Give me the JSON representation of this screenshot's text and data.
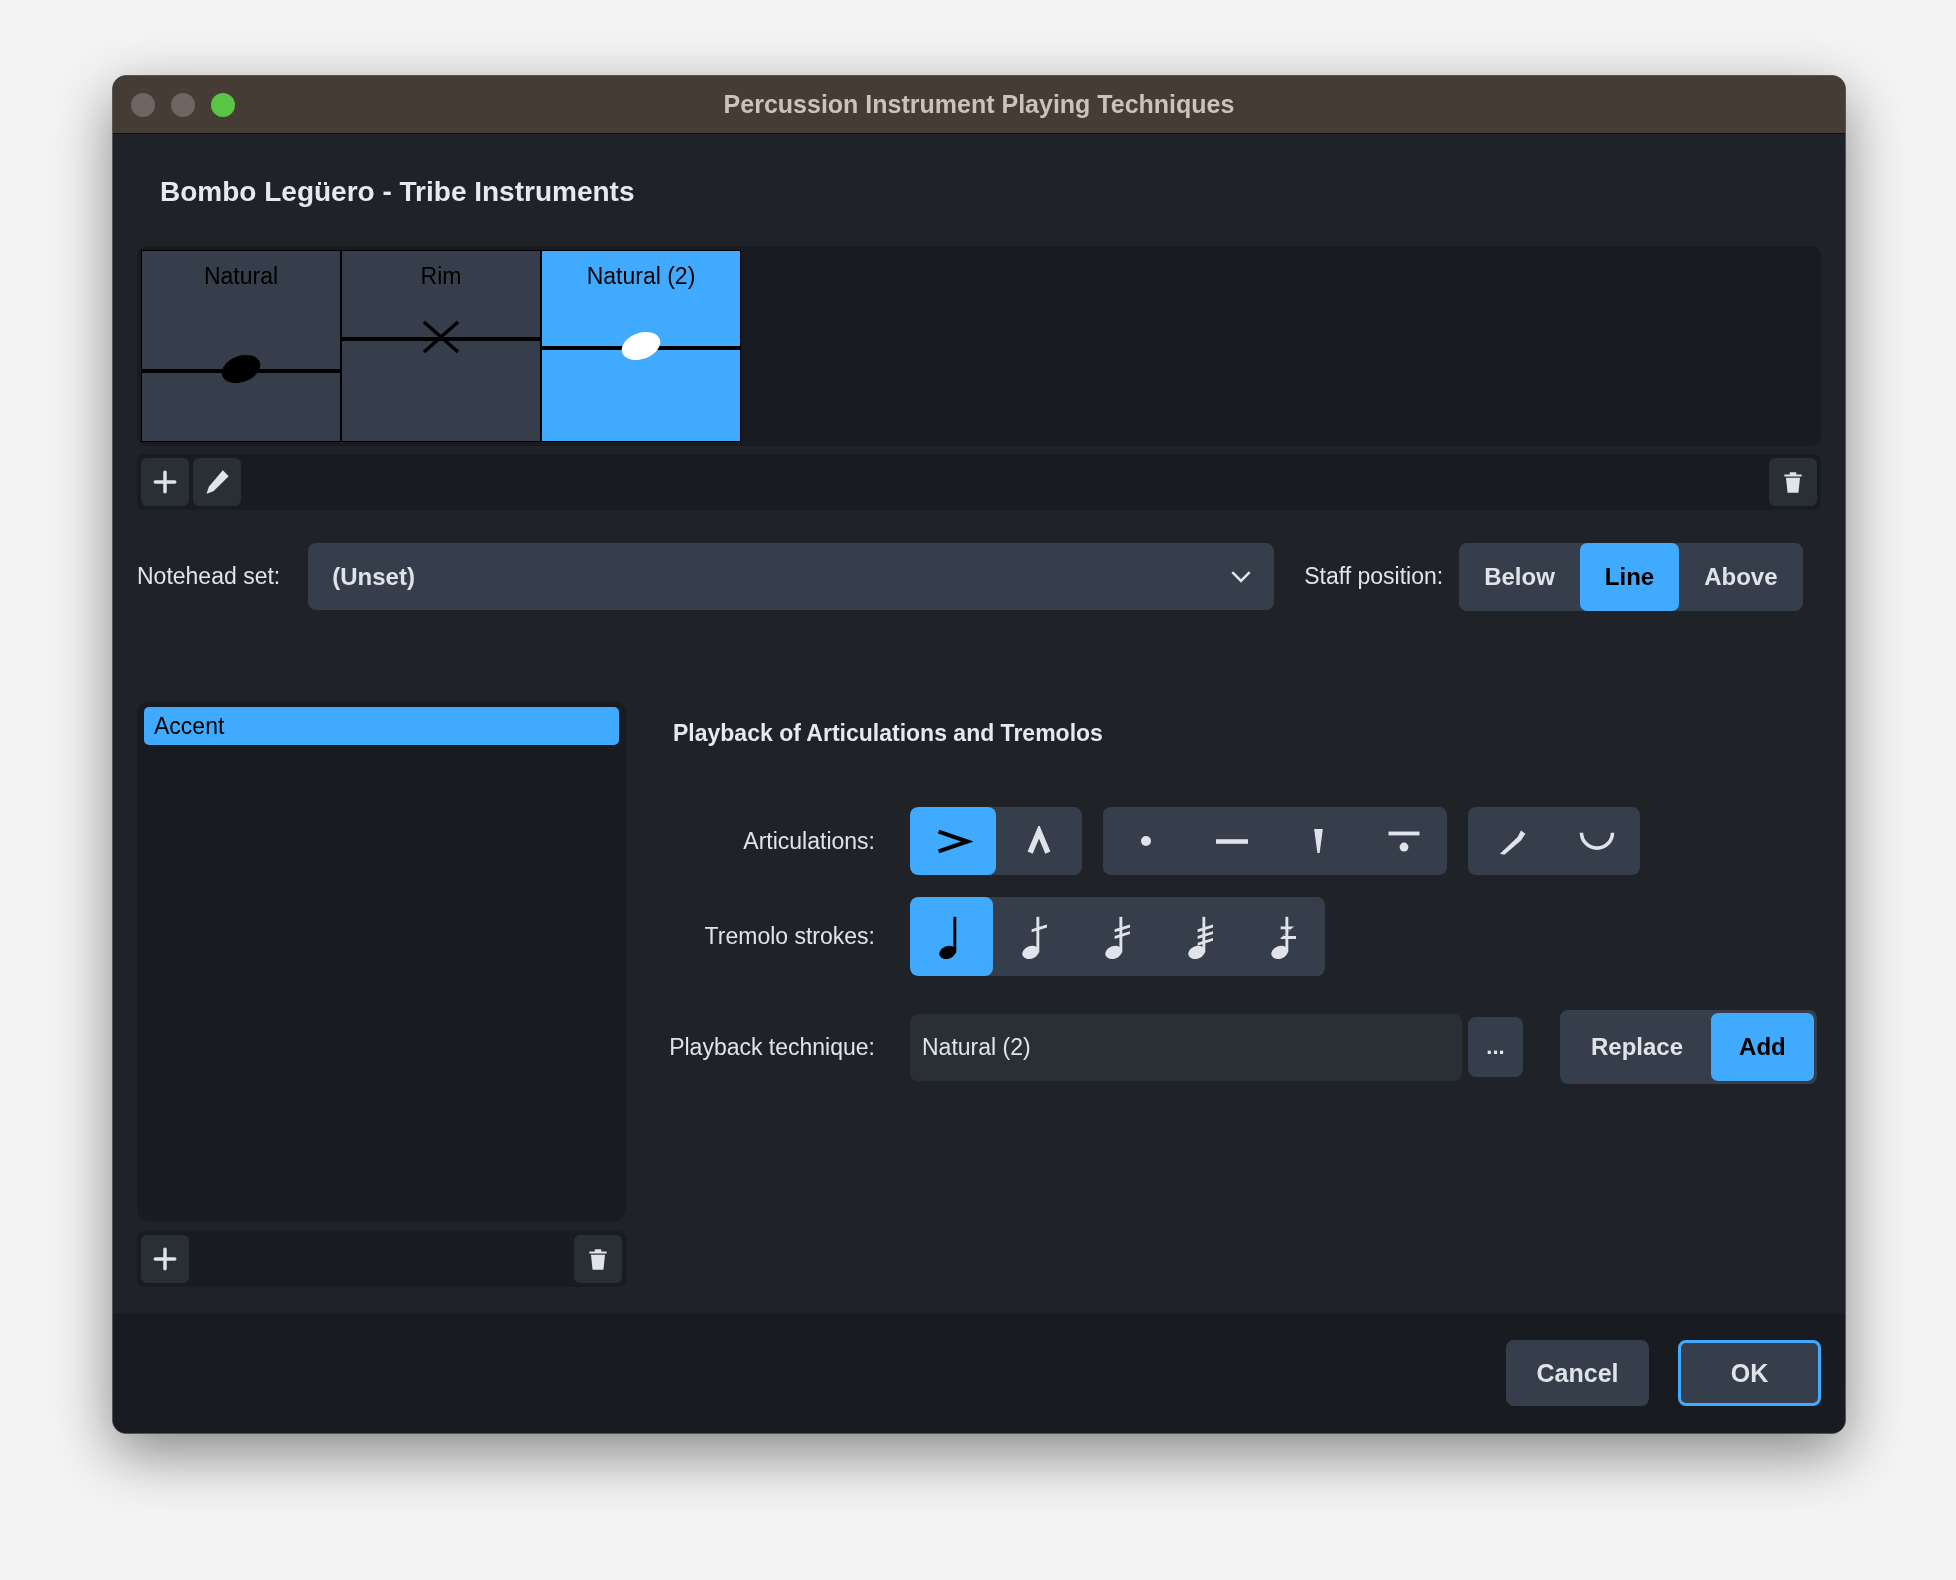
{
  "window": {
    "title": "Percussion Instrument Playing Techniques"
  },
  "heading": "Bombo Legüero - Tribe Instruments",
  "techniques": [
    {
      "label": "Natural",
      "kind": "filled",
      "selected": false
    },
    {
      "label": "Rim",
      "kind": "cross",
      "selected": false
    },
    {
      "label": "Natural (2)",
      "kind": "open",
      "selected": true
    }
  ],
  "notehead_set": {
    "label": "Notehead set:",
    "value": "(Unset)"
  },
  "staff_position": {
    "label": "Staff position:",
    "options": [
      {
        "label": "Below",
        "selected": false
      },
      {
        "label": "Line",
        "selected": true
      },
      {
        "label": "Above",
        "selected": false
      }
    ]
  },
  "articulation_list": {
    "items": [
      {
        "label": "Accent",
        "selected": true
      }
    ]
  },
  "playback": {
    "title": "Playback of Articulations and Tremolos",
    "articulations": {
      "label": "Articulations:",
      "groups": [
        [
          {
            "kind": "accent",
            "selected": true
          },
          {
            "kind": "marcato",
            "selected": false
          }
        ],
        [
          {
            "kind": "staccato",
            "selected": false
          },
          {
            "kind": "tenuto",
            "selected": false
          },
          {
            "kind": "staccatissimo",
            "selected": false
          },
          {
            "kind": "portato",
            "selected": false
          }
        ],
        [
          {
            "kind": "stress",
            "selected": false
          },
          {
            "kind": "unstress",
            "selected": false
          }
        ]
      ]
    },
    "tremolo": {
      "label": "Tremolo strokes:",
      "options": [
        {
          "kind": "none",
          "selected": true
        },
        {
          "kind": "one",
          "selected": false
        },
        {
          "kind": "two",
          "selected": false
        },
        {
          "kind": "three",
          "selected": false
        },
        {
          "kind": "buzz",
          "selected": false
        }
      ]
    },
    "technique": {
      "label": "Playback technique:",
      "value": "Natural (2)",
      "more": "...",
      "modes": [
        {
          "label": "Replace",
          "selected": false
        },
        {
          "label": "Add",
          "selected": true
        }
      ]
    }
  },
  "buttons": [
    {
      "label": "Cancel",
      "default": false
    },
    {
      "label": "OK",
      "default": true
    }
  ]
}
